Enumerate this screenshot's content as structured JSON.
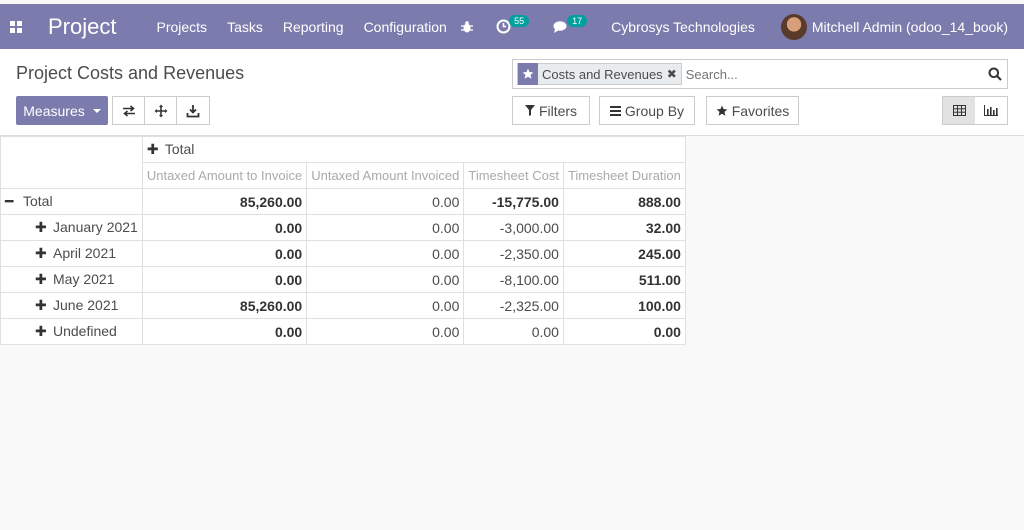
{
  "navbar": {
    "brand": "Project",
    "menu": [
      "Projects",
      "Tasks",
      "Reporting",
      "Configuration"
    ],
    "activity_count": "55",
    "messages_count": "17",
    "company": "Cybrosys Technologies",
    "user": "Mitchell Admin (odoo_14_book)"
  },
  "control": {
    "title": "Project Costs and Revenues",
    "facet_label": "Costs and Revenues",
    "search_placeholder": "Search...",
    "measures_label": "Measures",
    "filters_label": "Filters",
    "groupby_label": "Group By",
    "favorites_label": "Favorites"
  },
  "pivot": {
    "col_header": "Total",
    "measures": [
      "Untaxed Amount to Invoice",
      "Untaxed Amount Invoiced",
      "Timesheet Cost",
      "Timesheet Duration"
    ],
    "total_row": {
      "label": "Total",
      "values": [
        "85,260.00",
        "0.00",
        "-15,775.00",
        "888.00"
      ]
    },
    "rows": [
      {
        "label": "January 2021",
        "values": [
          "0.00",
          "0.00",
          "-3,000.00",
          "32.00"
        ]
      },
      {
        "label": "April 2021",
        "values": [
          "0.00",
          "0.00",
          "-2,350.00",
          "245.00"
        ]
      },
      {
        "label": "May 2021",
        "values": [
          "0.00",
          "0.00",
          "-8,100.00",
          "511.00"
        ]
      },
      {
        "label": "June 2021",
        "values": [
          "85,260.00",
          "0.00",
          "-2,325.00",
          "100.00"
        ]
      },
      {
        "label": "Undefined",
        "values": [
          "0.00",
          "0.00",
          "0.00",
          "0.00"
        ]
      }
    ]
  },
  "colors": {
    "brand": "#7c7bad",
    "badge": "#00a09d"
  }
}
